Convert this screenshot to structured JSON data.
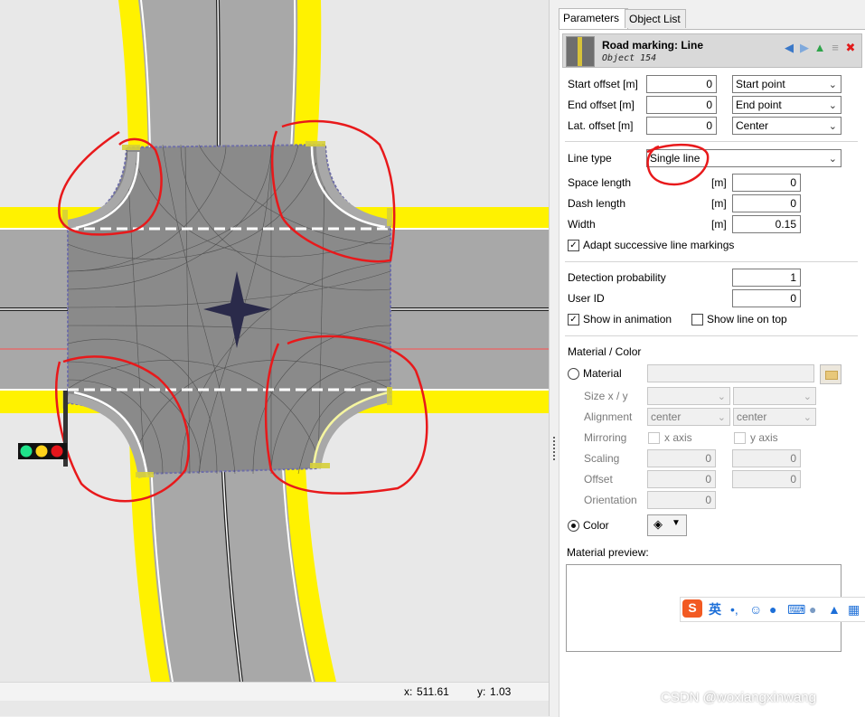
{
  "viewport": {
    "status_x_label": "x:",
    "status_x_value": "511.61",
    "status_y_label": "y:",
    "status_y_value": "1.03",
    "colors": {
      "ground": "#e8e8e8",
      "asphalt": "#a6a6a6",
      "junction": "#888888",
      "shoulder": "#fff200",
      "annotation": "#e8191b"
    }
  },
  "tabs": [
    {
      "label": "Parameters",
      "active": true
    },
    {
      "label": "Object List",
      "active": false
    }
  ],
  "header": {
    "title": "Road marking: Line",
    "subtitle": "Object 154",
    "icons": [
      "arrow-left-icon",
      "arrow-right-icon",
      "arrow-up-icon",
      "list-icon",
      "close-icon"
    ]
  },
  "offsets": {
    "start_label": "Start offset [m]",
    "start_value": "0",
    "start_select": "Start point",
    "end_label": "End offset  [m]",
    "end_value": "0",
    "end_select": "End point",
    "lat_label": "Lat. offset  [m]",
    "lat_value": "0",
    "lat_select": "Center"
  },
  "line": {
    "type_label": "Line type",
    "type_value": "Single line",
    "space_label": "Space length",
    "space_unit": "[m]",
    "space_value": "0",
    "dash_label": "Dash length",
    "dash_unit": "[m]",
    "dash_value": "0",
    "width_label": "Width",
    "width_unit": "[m]",
    "width_value": "0.15",
    "adapt_label": "Adapt successive line markings",
    "adapt_checked": true
  },
  "detection": {
    "prob_label": "Detection probability",
    "prob_value": "1",
    "userid_label": "User ID",
    "userid_value": "0",
    "show_anim_label": "Show in animation",
    "show_anim_checked": true,
    "show_top_label": "Show line on top",
    "show_top_checked": false
  },
  "material": {
    "section_label": "Material / Color",
    "material_radio_label": "Material",
    "material_selected": false,
    "size_label": "Size x / y",
    "alignment_label": "Alignment",
    "alignment_x": "center",
    "alignment_y": "center",
    "mirroring_label": "Mirroring",
    "x_axis_label": "x axis",
    "y_axis_label": "y axis",
    "scaling_label": "Scaling",
    "scaling_x": "0",
    "scaling_y": "0",
    "offset_label": "Offset",
    "offset_x": "0",
    "offset_y": "0",
    "orientation_label": "Orientation",
    "orientation_value": "0",
    "color_radio_label": "Color",
    "color_selected": true,
    "preview_label": "Material preview:"
  },
  "ime": {
    "logo": "S",
    "lang": "英",
    "items": [
      "punctuation-icon",
      "emoji-icon",
      "mic-icon",
      "keyboard-icon",
      "user-icon",
      "shirt-icon",
      "grid-icon"
    ]
  },
  "watermark": "CSDN @woxiangxinwang"
}
